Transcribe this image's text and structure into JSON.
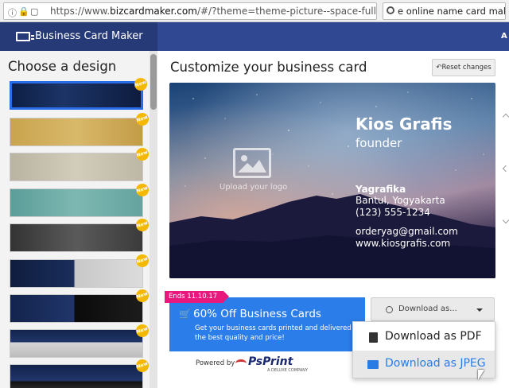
{
  "browser": {
    "url_prefix": "https://www.",
    "url_domain": "bizcardmaker.com",
    "url_rest": "/#/?theme=theme-picture--space-full",
    "search_value": "e online name card maker"
  },
  "header": {
    "title": "Business Card Maker",
    "right_text": "A"
  },
  "sidebar": {
    "title": "Choose a design",
    "badge_label": "New",
    "thumbnails": [
      {
        "name": "Space night",
        "selected": true
      },
      {
        "name": "Gold"
      },
      {
        "name": "Beige"
      },
      {
        "name": "Teal"
      },
      {
        "name": "Dark gray"
      },
      {
        "name": "Space left"
      },
      {
        "name": "Space dark"
      },
      {
        "name": "Space band"
      },
      {
        "name": "Space bottom"
      }
    ]
  },
  "main": {
    "title": "Customize your business card",
    "reset_label": "Reset changes"
  },
  "card": {
    "name": "Kios Grafis",
    "job_title": "founder",
    "company": "Yagrafika",
    "address": "Bantul, Yogyakarta",
    "phone": "(123) 555-1234",
    "email": "orderyag@gmail.com",
    "website": "www.kiosgrafis.com",
    "logo_label": "Upload your logo"
  },
  "promo": {
    "ends": "Ends 11.10.17",
    "headline": "60% Off Business Cards",
    "body": "Get your business cards printed and delivered at the best quality and price!",
    "powered_by": "Powered by",
    "brand": "PsPrint",
    "brand_sub": "A DELUXE COMPANY"
  },
  "download": {
    "button_label": "Download as...",
    "options": [
      "Download as PDF",
      "Download as JPEG"
    ]
  },
  "colors": {
    "header_dark": "#263a78",
    "header_right": "#2f4891",
    "promo_blue": "#2b7de9",
    "ends_pink": "#e8187c",
    "badge_yellow": "#f5b800",
    "selected_border": "#2a6be8"
  }
}
